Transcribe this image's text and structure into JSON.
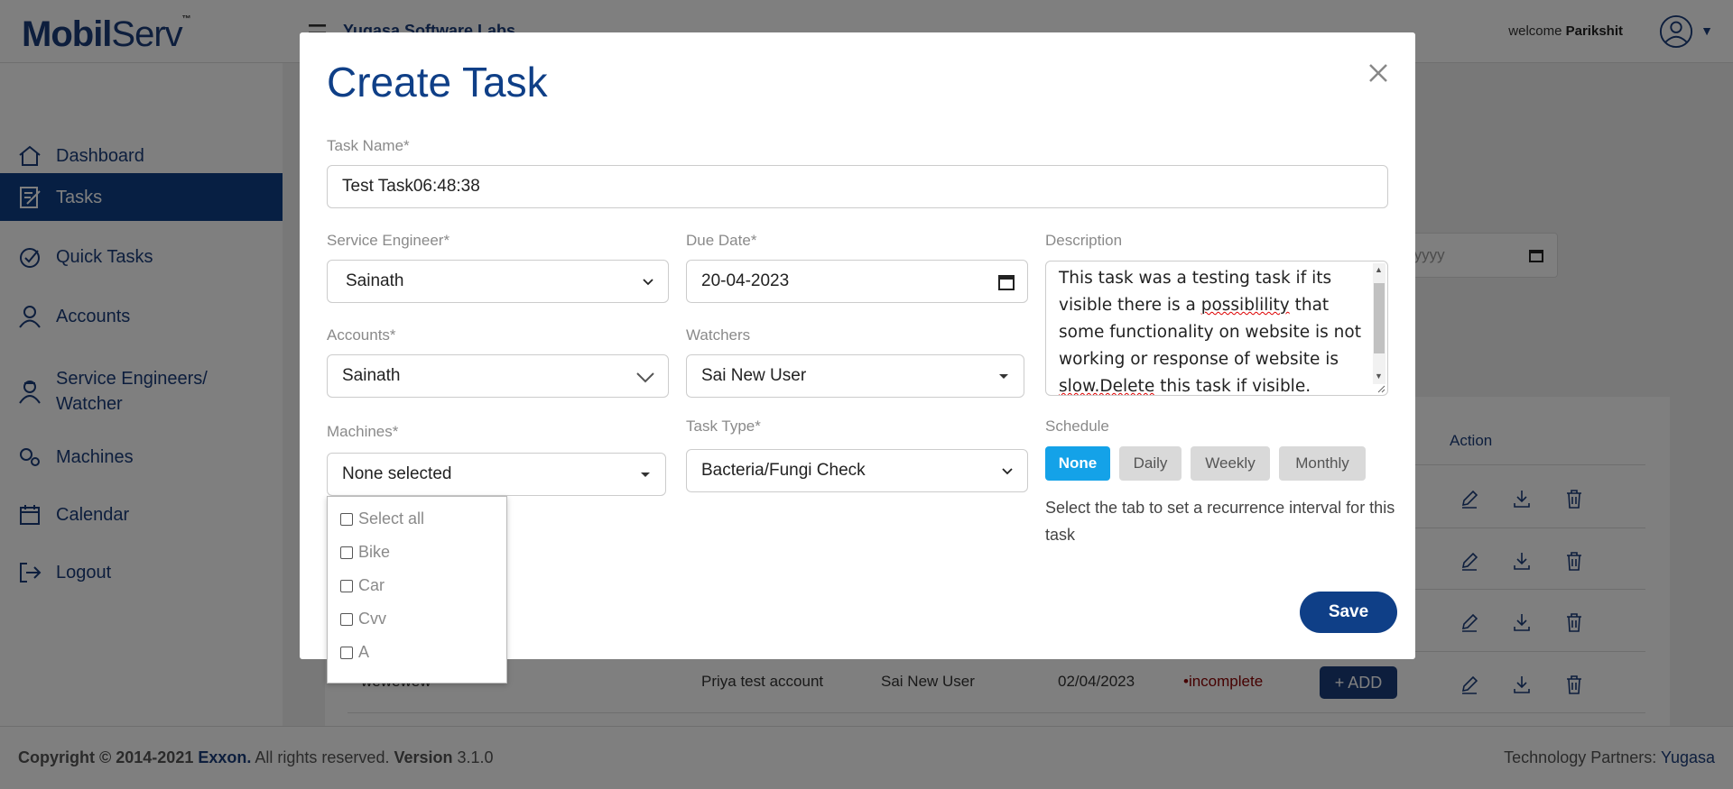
{
  "app": {
    "logo_mobil": "Mobil",
    "logo_serv": "Serv",
    "logo_tm": "™",
    "company": "Yugasa Software Labs",
    "welcome_prefix": "welcome",
    "welcome_user": "Parikshit"
  },
  "sidebar": {
    "items": [
      {
        "label": "Dashboard",
        "icon": "home-icon"
      },
      {
        "label": "Tasks",
        "icon": "task-icon"
      },
      {
        "label": "Quick Tasks",
        "icon": "quick-task-icon"
      },
      {
        "label": "Accounts",
        "icon": "accounts-icon"
      },
      {
        "label": "Service Engineers/",
        "label2": "Watcher",
        "icon": "engineer-icon"
      },
      {
        "label": "Machines",
        "icon": "machines-icon"
      },
      {
        "label": "Calendar",
        "icon": "calendar-icon"
      },
      {
        "label": "Logout",
        "icon": "logout-icon"
      }
    ],
    "active_index": 1
  },
  "background": {
    "date_placeholder": "-yyyy",
    "table_action_header": "Action",
    "last_row": {
      "name": "wewewew",
      "account": "Priya test account",
      "watcher": "Sai New User",
      "date": "02/04/2023",
      "status": "•incomplete",
      "add_label": "+ ADD"
    }
  },
  "modal": {
    "title": "Create Task",
    "task_name_label": "Task Name*",
    "task_name_value": "Test Task06:48:38",
    "engineer_label": "Service Engineer*",
    "engineer_value": "Sainath",
    "due_date_label": "Due Date*",
    "due_date_value": "20-04-2023",
    "description_label": "Description",
    "description_parts": [
      "This task was a testing task if its visible there is a ",
      "possiblility",
      " that some functionality on website is not working or response of website is ",
      "slow.Delete",
      " this task if visible."
    ],
    "accounts_label": "Accounts*",
    "accounts_value": "Sainath",
    "watchers_label": "Watchers",
    "watchers_value": "Sai New User",
    "machines_label": "Machines*",
    "machines_value": "None selected",
    "task_type_label": "Task Type*",
    "task_type_value": "Bacteria/Fungi Check",
    "schedule_label": "Schedule",
    "schedule_options": [
      "None",
      "Daily",
      "Weekly",
      "Monthly"
    ],
    "schedule_selected": "None",
    "schedule_note": "Select the tab to set a recurrence interval for this task",
    "save_label": "Save",
    "machines_options": [
      "Select all",
      "Bike",
      "Car",
      "Cvv",
      "A"
    ]
  },
  "footer": {
    "copyright_prefix": "Copyright © 2014-2021",
    "brand": "Exxon.",
    "rights": " All rights reserved.",
    "version_label": "Version",
    "version": "3.1.0",
    "partners_label": "Technology Partners:",
    "partner": "Yugasa"
  }
}
